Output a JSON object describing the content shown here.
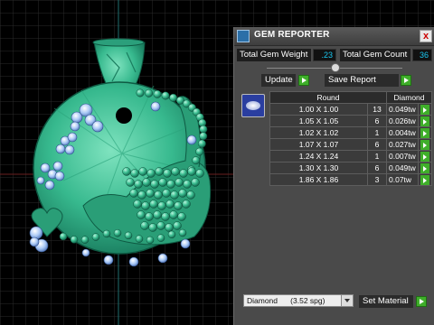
{
  "window": {
    "title": "GEM REPORTER",
    "close_label": "x"
  },
  "stats": {
    "weight_label": "Total Gem Weight",
    "weight_value": ".23",
    "count_label": "Total Gem Count",
    "count_value": "36"
  },
  "actions": {
    "update_label": "Update",
    "save_label": "Save Report"
  },
  "table": {
    "shape_header": "Round",
    "material_header": "Diamond",
    "rows": [
      {
        "size": "1.00 X 1.00",
        "count": "13",
        "weight": "0.049tw"
      },
      {
        "size": "1.05 X 1.05",
        "count": "6",
        "weight": "0.026tw"
      },
      {
        "size": "1.02 X 1.02",
        "count": "1",
        "weight": "0.004tw"
      },
      {
        "size": "1.07 X 1.07",
        "count": "6",
        "weight": "0.027tw"
      },
      {
        "size": "1.24 X 1.24",
        "count": "1",
        "weight": "0.007tw"
      },
      {
        "size": "1.30 X 1.30",
        "count": "6",
        "weight": "0.049tw"
      },
      {
        "size": "1.86 X 1.86",
        "count": "3",
        "weight": "0.07tw"
      }
    ]
  },
  "material": {
    "selected": "Diamond      (3.52 spg)",
    "set_label": "Set Material"
  },
  "colors": {
    "metal": "#37b98e",
    "gem": "#a9c8f5",
    "grid": "#2b2b2b",
    "accent_green": "#3fae2a",
    "value_cyan": "#19c7f0"
  }
}
